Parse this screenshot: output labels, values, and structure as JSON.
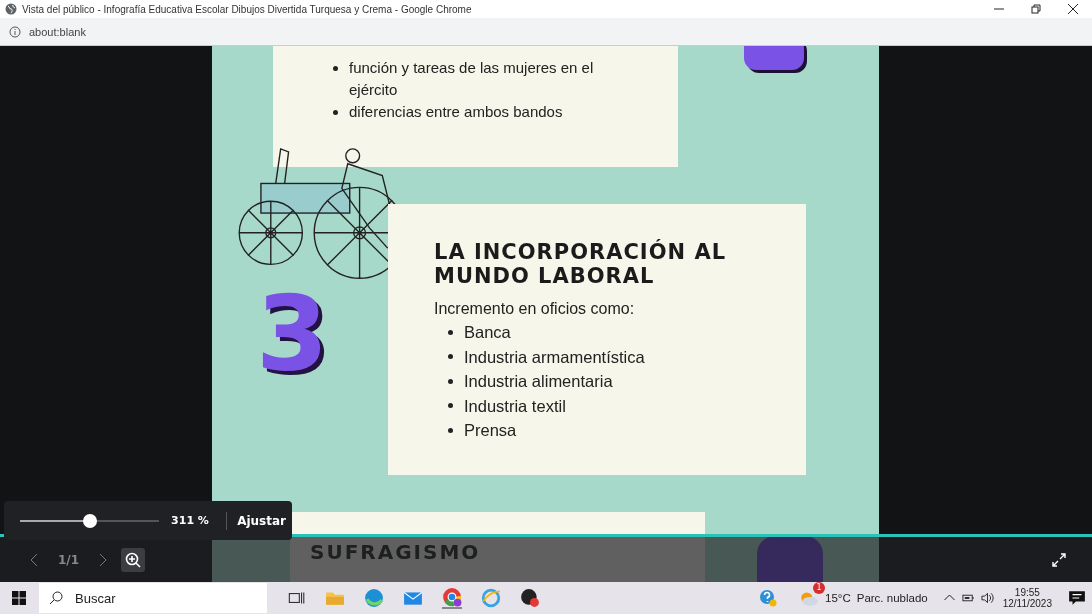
{
  "window": {
    "title": "Vista del público - Infografía Educativa Escolar Dibujos Divertida Turquesa y Crema - Google Chrome"
  },
  "address_bar": {
    "url": "about:blank"
  },
  "document": {
    "top_card": {
      "bullets": [
        "función y tareas de las mujeres en el ejército",
        "diferencias entre ambos bandos"
      ]
    },
    "section": {
      "number": "3",
      "heading": "LA INCORPORACIÓN AL MUNDO LABORAL",
      "intro": "Incremento en oficios como:",
      "bullets": [
        "Banca",
        "Industria armamentística",
        "Industria alimentaria",
        "Industria textil",
        "Prensa"
      ]
    },
    "next_section": {
      "heading": "SUFRAGISMO"
    }
  },
  "zoom_popup": {
    "level": 0.5,
    "reading": "311 %",
    "fit_button": "Ajustar"
  },
  "viewer_controls": {
    "page_indicator": "1/1"
  },
  "taskbar": {
    "search": {
      "placeholder": "Buscar"
    },
    "weather": {
      "badge": "1",
      "temperature": "15°C",
      "condition": "Parc. nublado"
    },
    "time": "19:55",
    "date": "12/11/2023"
  }
}
